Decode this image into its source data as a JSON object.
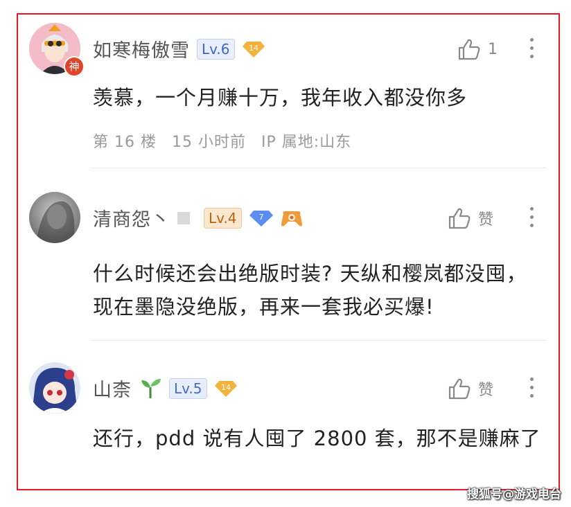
{
  "comments": [
    {
      "user": "如寒梅傲雪",
      "level": "Lv.6",
      "badge_num": "14",
      "avatar_tag": "神",
      "text": "羡慕，一个月赚十万，我年收入都没你多",
      "floor": "第 16 楼",
      "time": "15 小时前",
      "ip": "IP 属地:山东",
      "like_count": "1"
    },
    {
      "user": "清商怨丶",
      "level": "Lv.4",
      "badge_num": "7",
      "text": "什么时候还会出绝版时装? 天纵和樱岚都没囤，现在墨隐没绝版，再来一套我必买爆!",
      "like_label": "赞"
    },
    {
      "user": "山柰",
      "level": "Lv.5",
      "badge_num": "14",
      "text": "还行，pdd 说有人囤了 2800 套，那不是赚麻了",
      "like_label": "赞"
    }
  ],
  "watermark": "搜狐号@游戏电台",
  "colors": {
    "frame_border": "#e01b24",
    "badge_orange": "#f3b23c",
    "badge_blue": "#5b8ef0"
  }
}
